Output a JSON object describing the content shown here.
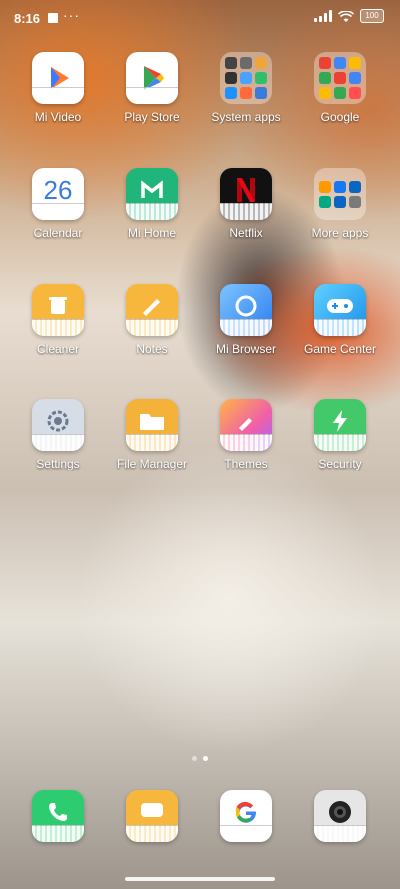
{
  "status": {
    "time": "8:16",
    "dots": "···",
    "battery": "100"
  },
  "apps": [
    {
      "label": "Mi Video",
      "icon": "mi-video-icon",
      "color": "#ffffff",
      "accent": "#2a7bff"
    },
    {
      "label": "Play Store",
      "icon": "play-store-icon",
      "color": "#ffffff",
      "accent": "#34a853"
    },
    {
      "label": "Calendar",
      "icon": "calendar-icon",
      "color": "#ffffff",
      "text": "26",
      "accent": "#3b7bde"
    },
    {
      "label": "Mi Home",
      "icon": "mi-home-icon",
      "color": "#1fb57b",
      "accent": "#ffffff"
    },
    {
      "label": "Netflix",
      "icon": "netflix-icon",
      "color": "#111111",
      "accent": "#e50914"
    },
    {
      "label": "Cleaner",
      "icon": "cleaner-icon",
      "color": "#f6b73c",
      "accent": "#ffffff"
    },
    {
      "label": "Notes",
      "icon": "notes-icon",
      "color": "#f6b73c",
      "accent": "#ffffff"
    },
    {
      "label": "Mi Browser",
      "icon": "mi-browser-icon",
      "color": "#4aa3ff",
      "accent": "#ffffff"
    },
    {
      "label": "Game Center",
      "icon": "game-center-icon",
      "color": "#2db7ff",
      "accent": "#ffffff"
    },
    {
      "label": "Settings",
      "icon": "settings-icon",
      "color": "#c9d3e0",
      "accent": "#6a7a90"
    },
    {
      "label": "File Manager",
      "icon": "file-manager-icon",
      "color": "#f5b23b",
      "accent": "#ffffff"
    },
    {
      "label": "Themes",
      "icon": "themes-icon",
      "color": "#f08ac7",
      "accent": "#ffb347"
    },
    {
      "label": "Security",
      "icon": "security-icon",
      "color": "#43c86a",
      "accent": "#ffffff"
    }
  ],
  "folders": [
    {
      "label": "System apps",
      "minis": [
        "#444444",
        "#6b6b6b",
        "#f0a53a",
        "#333333",
        "#4aa3ff",
        "#2fbf6a",
        "#1e90ff",
        "#ff6a3d",
        "#3b7bde"
      ]
    },
    {
      "label": "Google",
      "minis": [
        "#ea4335",
        "#4285f4",
        "#fbbc05",
        "#34a853",
        "#ea4335",
        "#4285f4",
        "#fbbc05",
        "#34a853",
        "#ff4f4f"
      ]
    },
    {
      "label": "More apps",
      "minis": [
        "#ff9900",
        "#1877f2",
        "#0a66c2",
        "#00a884",
        "#0a66c2",
        "#7a7a7a"
      ]
    }
  ],
  "dock": [
    {
      "label": "",
      "icon": "phone-icon",
      "color": "#2ecc71",
      "accent": "#ffffff"
    },
    {
      "label": "",
      "icon": "messages-icon",
      "color": "#f6b73c",
      "accent": "#ffffff"
    },
    {
      "label": "",
      "icon": "google-icon",
      "color": "#ffffff",
      "accent": "#4285f4"
    },
    {
      "label": "",
      "icon": "camera-icon",
      "color": "#e6e6e6",
      "accent": "#333333"
    }
  ],
  "pager": {
    "pages": 2,
    "active": 1
  }
}
